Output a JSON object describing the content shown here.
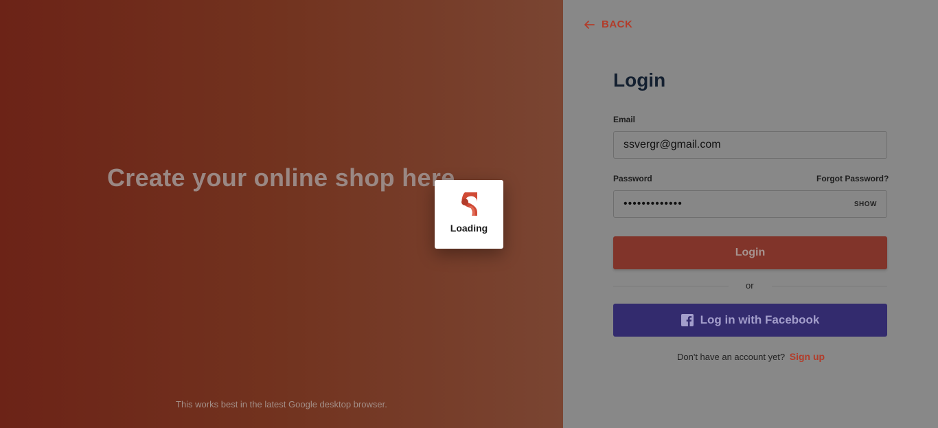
{
  "left": {
    "headline": "Create your online shop here",
    "browser_note": "This works best in the latest Google desktop browser."
  },
  "nav": {
    "back_label": "BACK"
  },
  "form": {
    "title": "Login",
    "email_label": "Email",
    "email_value": "ssvergr@gmail.com",
    "password_label": "Password",
    "forgot_label": "Forgot Password?",
    "password_value": "•••••••••••••",
    "show_label": "SHOW",
    "login_label": "Login",
    "or_label": "or",
    "facebook_label": "Log in with Facebook",
    "signup_prompt": "Don't have an account yet?",
    "signup_label": "Sign up"
  },
  "overlay": {
    "loading_label": "Loading"
  },
  "colors": {
    "accent": "#d04a35",
    "facebook": "#3b3489"
  },
  "icons": {
    "back": "arrow-left-icon",
    "facebook": "facebook-icon",
    "logo": "shop-logo-icon"
  }
}
